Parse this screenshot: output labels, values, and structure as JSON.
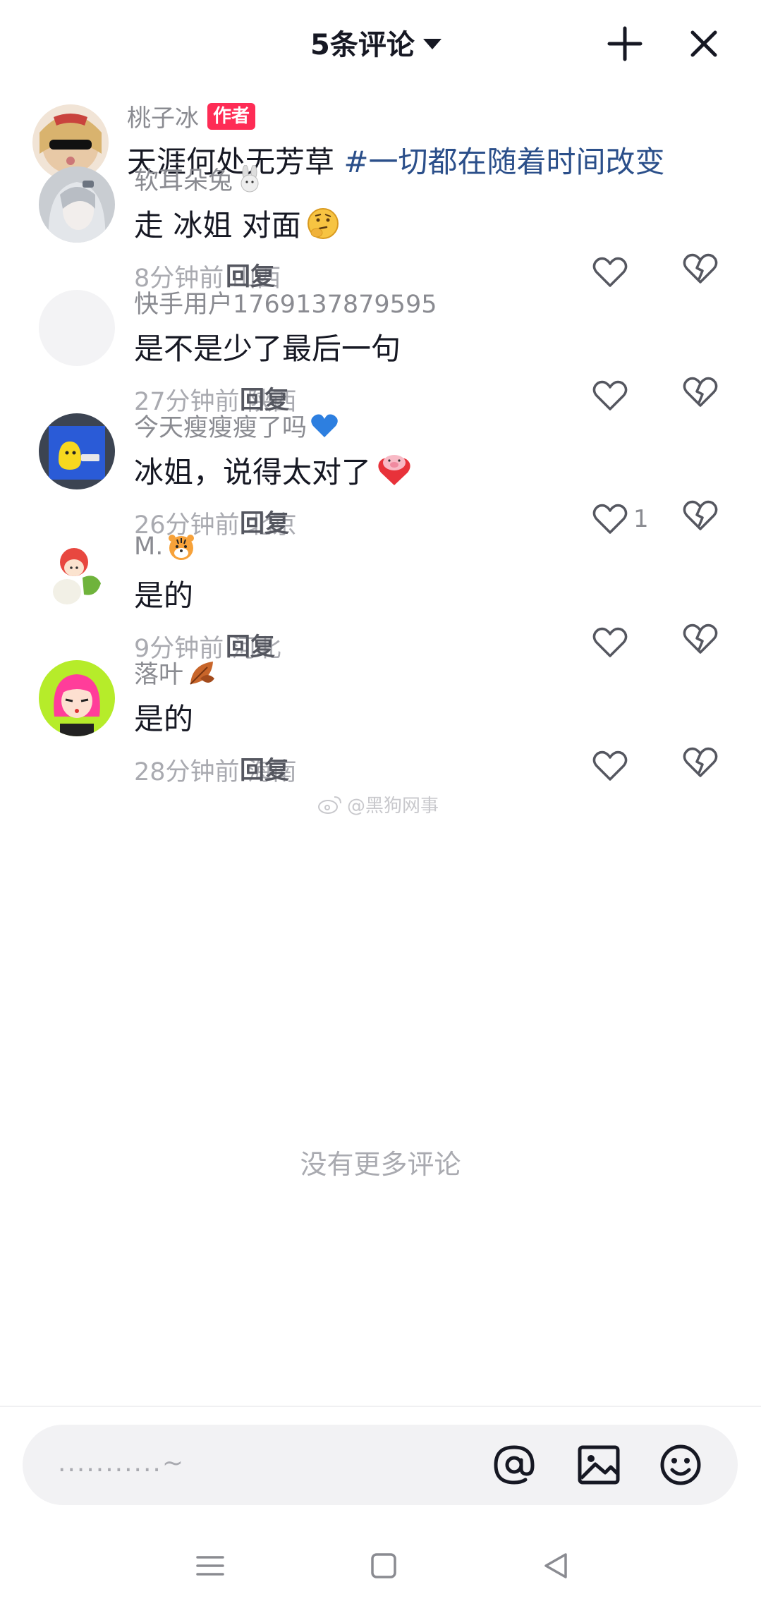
{
  "header": {
    "title": "5条评论",
    "icons": {
      "dropdown": "caret-down-icon",
      "minimize": "collapse-icon",
      "close": "close-icon"
    }
  },
  "author_post": {
    "username": "桃子冰",
    "badge": "作者",
    "text": "天涯何处无芳草 ",
    "hashtag": "#一切都在随着时间改变"
  },
  "comments": [
    {
      "username": "软耳朵兔",
      "name_emoji": "rabbit-emoji-icon",
      "text": "走 冰姐 对面",
      "text_emoji": "thinking-face-emoji-icon",
      "time": "8分钟前",
      "location": "山西",
      "reply": "回复",
      "likes": ""
    },
    {
      "username": "快手用户1769137879595",
      "name_emoji": "",
      "text": "是不是少了最后一句",
      "text_emoji": "",
      "time": "27分钟前",
      "location": "陕西",
      "reply": "回复",
      "likes": ""
    },
    {
      "username": "今天瘦瘦瘦了吗",
      "name_emoji": "blue-heart-emoji-icon",
      "text": "冰姐，说得太对了",
      "text_emoji": "pig-heart-emoji-icon",
      "time": "26分钟前",
      "location": "北京",
      "reply": "回复",
      "likes": "1"
    },
    {
      "username": "M.",
      "name_emoji": "tiger-emoji-icon",
      "text": "是的",
      "text_emoji": "",
      "time": "9分钟前",
      "location": "河北",
      "reply": "回复",
      "likes": ""
    },
    {
      "username": "落叶",
      "name_emoji": "fallen-leaf-emoji-icon",
      "text": "是的",
      "text_emoji": "",
      "time": "28分钟前",
      "location": "海南",
      "reply": "回复",
      "likes": ""
    }
  ],
  "end_text": "没有更多评论",
  "watermark": "@黑狗网事",
  "input": {
    "placeholder": "...........~",
    "icons": {
      "mention": "at-icon",
      "image": "image-icon",
      "emoji": "smiley-icon"
    }
  },
  "system_nav": {
    "menu": "menu-icon",
    "home": "home-square-icon",
    "back": "back-triangle-icon"
  },
  "colors": {
    "accent": "#fe2c55",
    "hashtag": "#2b4f8a",
    "meta": "#a9aab0",
    "name": "#8a8b91"
  }
}
